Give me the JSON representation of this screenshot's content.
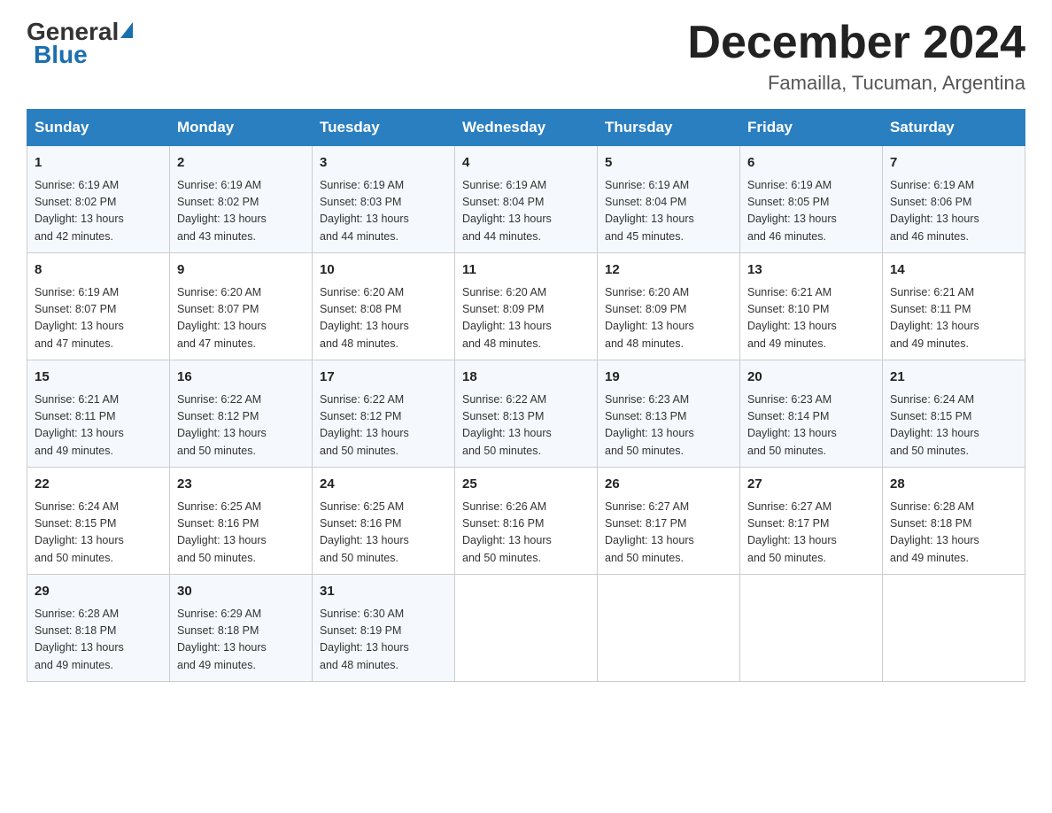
{
  "logo": {
    "general": "General",
    "triangle": "",
    "blue": "Blue"
  },
  "title": "December 2024",
  "subtitle": "Famailla, Tucuman, Argentina",
  "header_days": [
    "Sunday",
    "Monday",
    "Tuesday",
    "Wednesday",
    "Thursday",
    "Friday",
    "Saturday"
  ],
  "weeks": [
    [
      {
        "day": "1",
        "sunrise": "6:19 AM",
        "sunset": "8:02 PM",
        "daylight": "13 hours and 42 minutes."
      },
      {
        "day": "2",
        "sunrise": "6:19 AM",
        "sunset": "8:02 PM",
        "daylight": "13 hours and 43 minutes."
      },
      {
        "day": "3",
        "sunrise": "6:19 AM",
        "sunset": "8:03 PM",
        "daylight": "13 hours and 44 minutes."
      },
      {
        "day": "4",
        "sunrise": "6:19 AM",
        "sunset": "8:04 PM",
        "daylight": "13 hours and 44 minutes."
      },
      {
        "day": "5",
        "sunrise": "6:19 AM",
        "sunset": "8:04 PM",
        "daylight": "13 hours and 45 minutes."
      },
      {
        "day": "6",
        "sunrise": "6:19 AM",
        "sunset": "8:05 PM",
        "daylight": "13 hours and 46 minutes."
      },
      {
        "day": "7",
        "sunrise": "6:19 AM",
        "sunset": "8:06 PM",
        "daylight": "13 hours and 46 minutes."
      }
    ],
    [
      {
        "day": "8",
        "sunrise": "6:19 AM",
        "sunset": "8:07 PM",
        "daylight": "13 hours and 47 minutes."
      },
      {
        "day": "9",
        "sunrise": "6:20 AM",
        "sunset": "8:07 PM",
        "daylight": "13 hours and 47 minutes."
      },
      {
        "day": "10",
        "sunrise": "6:20 AM",
        "sunset": "8:08 PM",
        "daylight": "13 hours and 48 minutes."
      },
      {
        "day": "11",
        "sunrise": "6:20 AM",
        "sunset": "8:09 PM",
        "daylight": "13 hours and 48 minutes."
      },
      {
        "day": "12",
        "sunrise": "6:20 AM",
        "sunset": "8:09 PM",
        "daylight": "13 hours and 48 minutes."
      },
      {
        "day": "13",
        "sunrise": "6:21 AM",
        "sunset": "8:10 PM",
        "daylight": "13 hours and 49 minutes."
      },
      {
        "day": "14",
        "sunrise": "6:21 AM",
        "sunset": "8:11 PM",
        "daylight": "13 hours and 49 minutes."
      }
    ],
    [
      {
        "day": "15",
        "sunrise": "6:21 AM",
        "sunset": "8:11 PM",
        "daylight": "13 hours and 49 minutes."
      },
      {
        "day": "16",
        "sunrise": "6:22 AM",
        "sunset": "8:12 PM",
        "daylight": "13 hours and 50 minutes."
      },
      {
        "day": "17",
        "sunrise": "6:22 AM",
        "sunset": "8:12 PM",
        "daylight": "13 hours and 50 minutes."
      },
      {
        "day": "18",
        "sunrise": "6:22 AM",
        "sunset": "8:13 PM",
        "daylight": "13 hours and 50 minutes."
      },
      {
        "day": "19",
        "sunrise": "6:23 AM",
        "sunset": "8:13 PM",
        "daylight": "13 hours and 50 minutes."
      },
      {
        "day": "20",
        "sunrise": "6:23 AM",
        "sunset": "8:14 PM",
        "daylight": "13 hours and 50 minutes."
      },
      {
        "day": "21",
        "sunrise": "6:24 AM",
        "sunset": "8:15 PM",
        "daylight": "13 hours and 50 minutes."
      }
    ],
    [
      {
        "day": "22",
        "sunrise": "6:24 AM",
        "sunset": "8:15 PM",
        "daylight": "13 hours and 50 minutes."
      },
      {
        "day": "23",
        "sunrise": "6:25 AM",
        "sunset": "8:16 PM",
        "daylight": "13 hours and 50 minutes."
      },
      {
        "day": "24",
        "sunrise": "6:25 AM",
        "sunset": "8:16 PM",
        "daylight": "13 hours and 50 minutes."
      },
      {
        "day": "25",
        "sunrise": "6:26 AM",
        "sunset": "8:16 PM",
        "daylight": "13 hours and 50 minutes."
      },
      {
        "day": "26",
        "sunrise": "6:27 AM",
        "sunset": "8:17 PM",
        "daylight": "13 hours and 50 minutes."
      },
      {
        "day": "27",
        "sunrise": "6:27 AM",
        "sunset": "8:17 PM",
        "daylight": "13 hours and 50 minutes."
      },
      {
        "day": "28",
        "sunrise": "6:28 AM",
        "sunset": "8:18 PM",
        "daylight": "13 hours and 49 minutes."
      }
    ],
    [
      {
        "day": "29",
        "sunrise": "6:28 AM",
        "sunset": "8:18 PM",
        "daylight": "13 hours and 49 minutes."
      },
      {
        "day": "30",
        "sunrise": "6:29 AM",
        "sunset": "8:18 PM",
        "daylight": "13 hours and 49 minutes."
      },
      {
        "day": "31",
        "sunrise": "6:30 AM",
        "sunset": "8:19 PM",
        "daylight": "13 hours and 48 minutes."
      },
      null,
      null,
      null,
      null
    ]
  ],
  "labels": {
    "sunrise": "Sunrise:",
    "sunset": "Sunset:",
    "daylight": "Daylight:"
  }
}
